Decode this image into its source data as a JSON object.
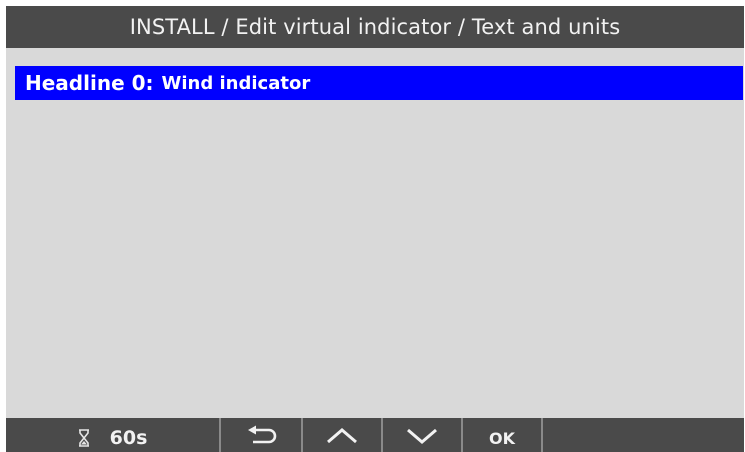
{
  "title": "INSTALL / Edit virtual indicator / Text and units",
  "list": {
    "items": [
      {
        "label": "Headline 0:",
        "value": "Wind indicator",
        "selected": true
      }
    ]
  },
  "softkeys": {
    "timer_icon": "hourglass-icon",
    "timer_label": "60s",
    "back_icon": "return-arrow-icon",
    "up_icon": "chevron-up-icon",
    "down_icon": "chevron-down-icon",
    "ok_label": "OK"
  },
  "colors": {
    "title_bar": "#4a4a4a",
    "background": "#d9d9d9",
    "selection": "#0000ff",
    "softkey_bar": "#4a4a4a",
    "text_light": "#f2f2f2"
  }
}
